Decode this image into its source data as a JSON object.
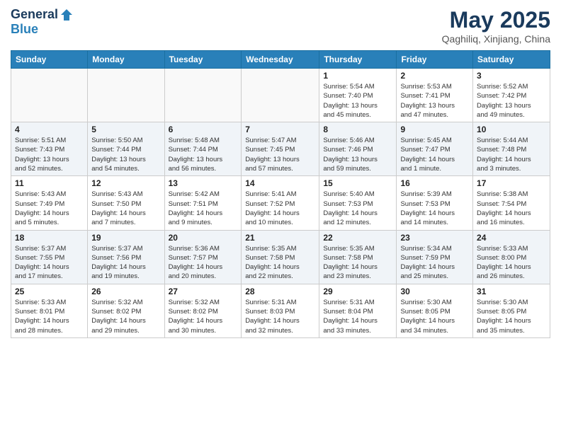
{
  "logo": {
    "text_general": "General",
    "text_blue": "Blue"
  },
  "header": {
    "month": "May 2025",
    "location": "Qaghiliq, Xinjiang, China"
  },
  "weekdays": [
    "Sunday",
    "Monday",
    "Tuesday",
    "Wednesday",
    "Thursday",
    "Friday",
    "Saturday"
  ],
  "weeks": [
    [
      {
        "day": "",
        "info": ""
      },
      {
        "day": "",
        "info": ""
      },
      {
        "day": "",
        "info": ""
      },
      {
        "day": "",
        "info": ""
      },
      {
        "day": "1",
        "info": "Sunrise: 5:54 AM\nSunset: 7:40 PM\nDaylight: 13 hours\nand 45 minutes."
      },
      {
        "day": "2",
        "info": "Sunrise: 5:53 AM\nSunset: 7:41 PM\nDaylight: 13 hours\nand 47 minutes."
      },
      {
        "day": "3",
        "info": "Sunrise: 5:52 AM\nSunset: 7:42 PM\nDaylight: 13 hours\nand 49 minutes."
      }
    ],
    [
      {
        "day": "4",
        "info": "Sunrise: 5:51 AM\nSunset: 7:43 PM\nDaylight: 13 hours\nand 52 minutes."
      },
      {
        "day": "5",
        "info": "Sunrise: 5:50 AM\nSunset: 7:44 PM\nDaylight: 13 hours\nand 54 minutes."
      },
      {
        "day": "6",
        "info": "Sunrise: 5:48 AM\nSunset: 7:44 PM\nDaylight: 13 hours\nand 56 minutes."
      },
      {
        "day": "7",
        "info": "Sunrise: 5:47 AM\nSunset: 7:45 PM\nDaylight: 13 hours\nand 57 minutes."
      },
      {
        "day": "8",
        "info": "Sunrise: 5:46 AM\nSunset: 7:46 PM\nDaylight: 13 hours\nand 59 minutes."
      },
      {
        "day": "9",
        "info": "Sunrise: 5:45 AM\nSunset: 7:47 PM\nDaylight: 14 hours\nand 1 minute."
      },
      {
        "day": "10",
        "info": "Sunrise: 5:44 AM\nSunset: 7:48 PM\nDaylight: 14 hours\nand 3 minutes."
      }
    ],
    [
      {
        "day": "11",
        "info": "Sunrise: 5:43 AM\nSunset: 7:49 PM\nDaylight: 14 hours\nand 5 minutes."
      },
      {
        "day": "12",
        "info": "Sunrise: 5:43 AM\nSunset: 7:50 PM\nDaylight: 14 hours\nand 7 minutes."
      },
      {
        "day": "13",
        "info": "Sunrise: 5:42 AM\nSunset: 7:51 PM\nDaylight: 14 hours\nand 9 minutes."
      },
      {
        "day": "14",
        "info": "Sunrise: 5:41 AM\nSunset: 7:52 PM\nDaylight: 14 hours\nand 10 minutes."
      },
      {
        "day": "15",
        "info": "Sunrise: 5:40 AM\nSunset: 7:53 PM\nDaylight: 14 hours\nand 12 minutes."
      },
      {
        "day": "16",
        "info": "Sunrise: 5:39 AM\nSunset: 7:53 PM\nDaylight: 14 hours\nand 14 minutes."
      },
      {
        "day": "17",
        "info": "Sunrise: 5:38 AM\nSunset: 7:54 PM\nDaylight: 14 hours\nand 16 minutes."
      }
    ],
    [
      {
        "day": "18",
        "info": "Sunrise: 5:37 AM\nSunset: 7:55 PM\nDaylight: 14 hours\nand 17 minutes."
      },
      {
        "day": "19",
        "info": "Sunrise: 5:37 AM\nSunset: 7:56 PM\nDaylight: 14 hours\nand 19 minutes."
      },
      {
        "day": "20",
        "info": "Sunrise: 5:36 AM\nSunset: 7:57 PM\nDaylight: 14 hours\nand 20 minutes."
      },
      {
        "day": "21",
        "info": "Sunrise: 5:35 AM\nSunset: 7:58 PM\nDaylight: 14 hours\nand 22 minutes."
      },
      {
        "day": "22",
        "info": "Sunrise: 5:35 AM\nSunset: 7:58 PM\nDaylight: 14 hours\nand 23 minutes."
      },
      {
        "day": "23",
        "info": "Sunrise: 5:34 AM\nSunset: 7:59 PM\nDaylight: 14 hours\nand 25 minutes."
      },
      {
        "day": "24",
        "info": "Sunrise: 5:33 AM\nSunset: 8:00 PM\nDaylight: 14 hours\nand 26 minutes."
      }
    ],
    [
      {
        "day": "25",
        "info": "Sunrise: 5:33 AM\nSunset: 8:01 PM\nDaylight: 14 hours\nand 28 minutes."
      },
      {
        "day": "26",
        "info": "Sunrise: 5:32 AM\nSunset: 8:02 PM\nDaylight: 14 hours\nand 29 minutes."
      },
      {
        "day": "27",
        "info": "Sunrise: 5:32 AM\nSunset: 8:02 PM\nDaylight: 14 hours\nand 30 minutes."
      },
      {
        "day": "28",
        "info": "Sunrise: 5:31 AM\nSunset: 8:03 PM\nDaylight: 14 hours\nand 32 minutes."
      },
      {
        "day": "29",
        "info": "Sunrise: 5:31 AM\nSunset: 8:04 PM\nDaylight: 14 hours\nand 33 minutes."
      },
      {
        "day": "30",
        "info": "Sunrise: 5:30 AM\nSunset: 8:05 PM\nDaylight: 14 hours\nand 34 minutes."
      },
      {
        "day": "31",
        "info": "Sunrise: 5:30 AM\nSunset: 8:05 PM\nDaylight: 14 hours\nand 35 minutes."
      }
    ]
  ]
}
